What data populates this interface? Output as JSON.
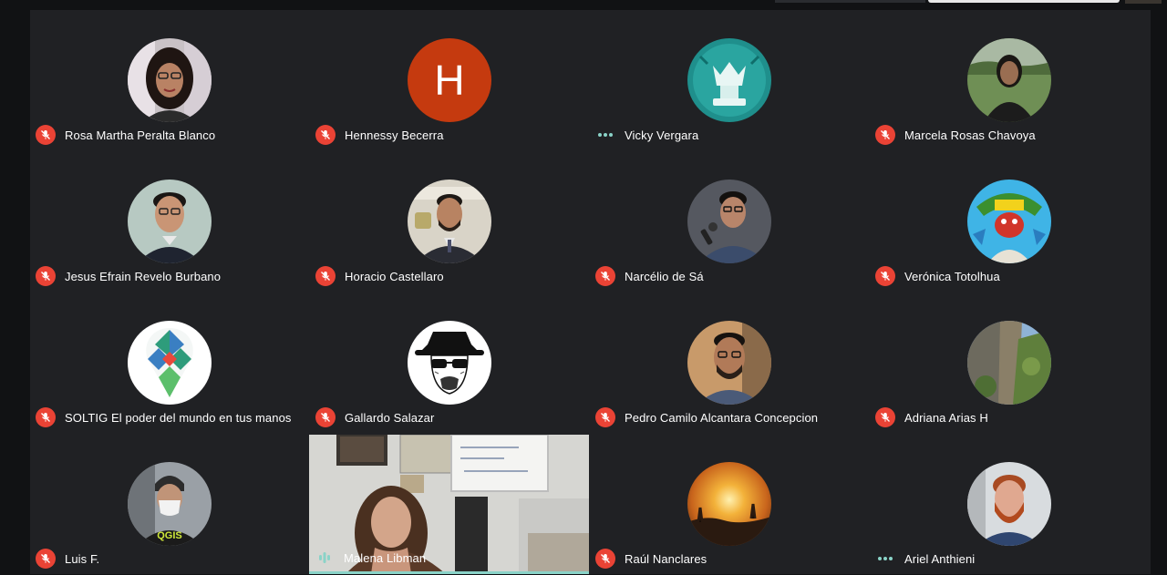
{
  "participants": [
    {
      "name": "Rosa Martha Peralta Blanco",
      "status": "muted",
      "avatar": "photo-woman-glasses"
    },
    {
      "name": "Hennessy Becerra",
      "status": "muted",
      "avatar": "initial",
      "initial": "H",
      "avatar_color": "#c53a0f"
    },
    {
      "name": "Vicky Vergara",
      "status": "connecting",
      "avatar": "chess-queen-logo"
    },
    {
      "name": "Marcela Rosas Chavoya",
      "status": "muted",
      "avatar": "photo-woman-outdoors"
    },
    {
      "name": "Jesus Efrain Revelo Burbano",
      "status": "muted",
      "avatar": "photo-man-glasses"
    },
    {
      "name": "Horacio Castellaro",
      "status": "muted",
      "avatar": "photo-man-suit"
    },
    {
      "name": "Narcélio de Sá",
      "status": "muted",
      "avatar": "photo-man-microphone"
    },
    {
      "name": "Verónica Totolhua",
      "status": "muted",
      "avatar": "illustration-character"
    },
    {
      "name": "SOLTIG El poder del mundo en tus manos",
      "status": "muted",
      "avatar": "soltig-map-pin-logo"
    },
    {
      "name": "Gallardo Salazar",
      "status": "muted",
      "avatar": "heisenberg-sketch"
    },
    {
      "name": "Pedro Camilo Alcantara Concepcion",
      "status": "muted",
      "avatar": "photo-man-beard"
    },
    {
      "name": "Adriana Arias H",
      "status": "muted",
      "avatar": "photo-cliff-landscape"
    },
    {
      "name": "Luis F.",
      "status": "muted",
      "avatar": "photo-man-helmet-mask"
    },
    {
      "name": "Malena Libman",
      "status": "speaking",
      "avatar": "live-video"
    },
    {
      "name": "Raúl Nanclares",
      "status": "muted",
      "avatar": "photo-sunset"
    },
    {
      "name": "Ariel Anthieni",
      "status": "connecting",
      "avatar": "photo-man-red-beard"
    }
  ],
  "colors": {
    "background": "#202124",
    "muted_badge": "#ea4335",
    "speaking_accent": "#8ad3c8"
  }
}
